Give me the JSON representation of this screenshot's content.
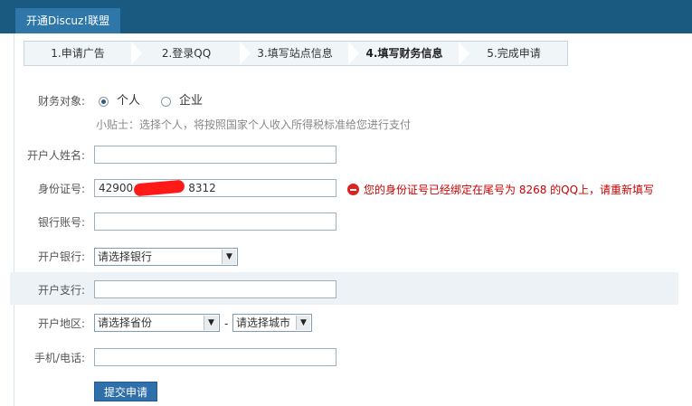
{
  "header": {
    "title": "开通Discuz!联盟"
  },
  "steps": [
    {
      "label": "1.申请广告",
      "active": false
    },
    {
      "label": "2.登录QQ",
      "active": false
    },
    {
      "label": "3.填写站点信息",
      "active": false
    },
    {
      "label": "4.填写财务信息",
      "active": true
    },
    {
      "label": "5.完成申请",
      "active": false
    }
  ],
  "form": {
    "finance_target_label": "财务对象:",
    "option_personal": "个人",
    "option_company": "企业",
    "tip": "小贴士：选择个人，将按照国家个人收入所得税标准给您进行支付",
    "name_label": "开户人姓名:",
    "name_value": "",
    "id_label": "身份证号:",
    "id_value_prefix": "42900",
    "id_value_suffix": "8312",
    "id_error": "您的身份证号已经绑定在尾号为 8268 的QQ上，请重新填写",
    "account_label": "银行账号:",
    "account_value": "",
    "bank_label": "开户银行:",
    "bank_selected": "请选择银行",
    "branch_label": "开户支行:",
    "branch_value": "",
    "region_label": "开户地区:",
    "province_selected": "请选择省份",
    "region_separator": "-",
    "city_selected": "请选择城市",
    "phone_label": "手机/电话:",
    "phone_value": "",
    "submit_label": "提交申请"
  },
  "colors": {
    "header_bg": "#1a5a80",
    "error_text": "#cc0000",
    "button_bg": "#2f6faa"
  }
}
